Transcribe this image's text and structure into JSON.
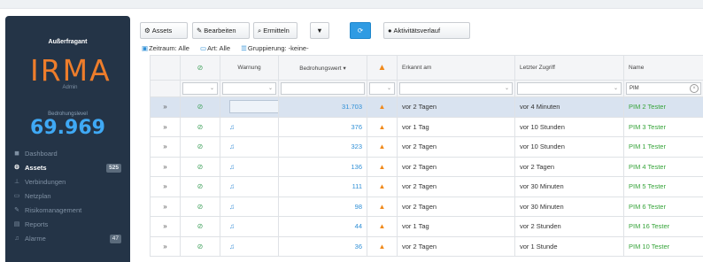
{
  "sidebar": {
    "status": "Außerfragant",
    "logo": "IRMA",
    "logo_sub": "Admin",
    "threat_label": "Bedrohungslevel",
    "threat_value": "69.969",
    "menu": [
      {
        "label": "Dashboard",
        "icon": "dashboard-icon",
        "glyph": "◼",
        "badge": ""
      },
      {
        "label": "Assets",
        "icon": "assets-icon",
        "glyph": "⚙",
        "badge": "525",
        "active": true
      },
      {
        "label": "Verbindungen",
        "icon": "connections-icon",
        "glyph": "⊥",
        "badge": ""
      },
      {
        "label": "Netzplan",
        "icon": "network-plan-icon",
        "glyph": "▭",
        "badge": ""
      },
      {
        "label": "Risikomanagement",
        "icon": "risk-icon",
        "glyph": "✎",
        "badge": ""
      },
      {
        "label": "Reports",
        "icon": "reports-icon",
        "glyph": "▤",
        "badge": ""
      },
      {
        "label": "Alarme",
        "icon": "alarm-icon",
        "glyph": "♫",
        "badge": "47"
      }
    ]
  },
  "toolbar": {
    "assets": "Assets",
    "edit": "Bearbeiten",
    "detect": "Ermitteln",
    "activity": "Aktivitätsverlauf"
  },
  "filters": {
    "zeitraum": "Zeitraum: Alle",
    "art": "Art: Alle",
    "grouping": "Gruppierung: -keine-"
  },
  "table": {
    "headers": {
      "warning": "Warnung",
      "threat": "Bedrohungswert",
      "detected": "Erkannt am",
      "last_access": "Letzter Zugriff",
      "name": "Name"
    },
    "name_filter": "PIM",
    "rows": [
      {
        "threat": "31.703",
        "detected": "vor 2 Tagen",
        "last": "vor 4 Minuten",
        "name": "PIM 2 Tester",
        "selected": true
      },
      {
        "threat": "376",
        "detected": "vor 1 Tag",
        "last": "vor 10 Stunden",
        "name": "PIM 3 Tester"
      },
      {
        "threat": "323",
        "detected": "vor 2 Tagen",
        "last": "vor 10 Stunden",
        "name": "PIM 1 Tester"
      },
      {
        "threat": "136",
        "detected": "vor 2 Tagen",
        "last": "vor 2 Tagen",
        "name": "PIM 4 Tester"
      },
      {
        "threat": "111",
        "detected": "vor 2 Tagen",
        "last": "vor 30 Minuten",
        "name": "PIM 5 Tester"
      },
      {
        "threat": "98",
        "detected": "vor 2 Tagen",
        "last": "vor 30 Minuten",
        "name": "PIM 6 Tester"
      },
      {
        "threat": "44",
        "detected": "vor 1 Tag",
        "last": "vor 2 Stunden",
        "name": "PIM 16 Tester"
      },
      {
        "threat": "36",
        "detected": "vor 2 Tagen",
        "last": "vor 1 Stunde",
        "name": "PIM 10 Tester"
      }
    ]
  },
  "colors": {
    "sidebar_bg": "#243447",
    "logo": "#ee7d2b",
    "threat_value": "#3fa9f5",
    "name_green": "#36a43a",
    "warning_orange": "#f08a1c"
  }
}
